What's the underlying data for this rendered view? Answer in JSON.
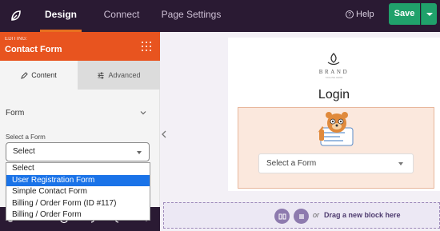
{
  "topbar": {
    "tabs": [
      "Design",
      "Connect",
      "Page Settings"
    ],
    "help_label": "Help",
    "save_label": "Save",
    "logo_icon": "seedprod-leaf-icon"
  },
  "sidebar": {
    "editing_label": "EDITING:",
    "editing_title": "Contact Form",
    "tabs": {
      "content": "Content",
      "advanced": "Advanced"
    },
    "section_title": "Form",
    "field_label": "Select a Form",
    "select_value": "Select",
    "options": [
      "Select",
      "User Registration Form",
      "Simple Contact Form",
      "Billing / Order Form (ID #117)",
      "Billing / Order Form"
    ],
    "selected_index": 1,
    "colors": {
      "accent": "#e8541f",
      "highlight": "#1a73e8"
    }
  },
  "preview": {
    "brand_name": "BRAND",
    "brand_tagline": "TAGLINE HERE",
    "login_title": "Login",
    "form_placeholder": "Select a Form",
    "dropzone": {
      "or_text": "or",
      "cta": "Drag a new block here"
    }
  }
}
